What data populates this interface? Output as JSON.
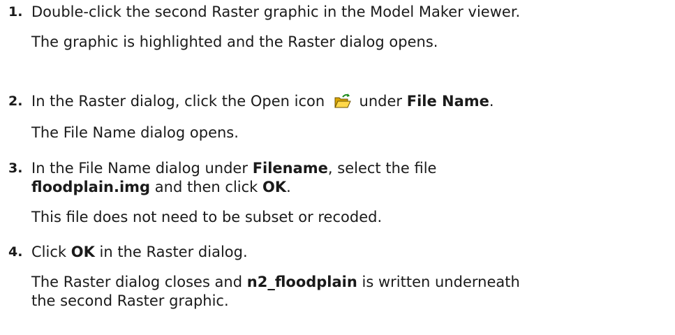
{
  "steps": [
    {
      "number": "1.",
      "instruction": "Double-click the second Raster graphic in the Model Maker viewer.",
      "result": "The graphic is highlighted and the Raster dialog opens."
    },
    {
      "number": "2.",
      "instruction_a": "In the Raster dialog, click the Open icon",
      "instruction_b": "under",
      "instruction_bold": "File Name",
      "instruction_end": ".",
      "icon": "open-folder-icon",
      "result": "The File Name dialog opens."
    },
    {
      "number": "3.",
      "instruction_a": "In the File Name dialog under",
      "instruction_bold1": "Filename",
      "instruction_b": ", select the file",
      "instruction_bold2": "floodplain.img",
      "instruction_c": "and then click",
      "instruction_bold3": "OK",
      "instruction_end": ".",
      "result": "This file does not need to be subset or recoded."
    },
    {
      "number": "4.",
      "instruction_a": "Click",
      "instruction_bold": "OK",
      "instruction_b": "in the Raster dialog.",
      "result_a": "The Raster dialog closes and",
      "result_bold": "n2_floodplain",
      "result_b": "is written underneath",
      "result_c": "the second Raster graphic."
    }
  ]
}
